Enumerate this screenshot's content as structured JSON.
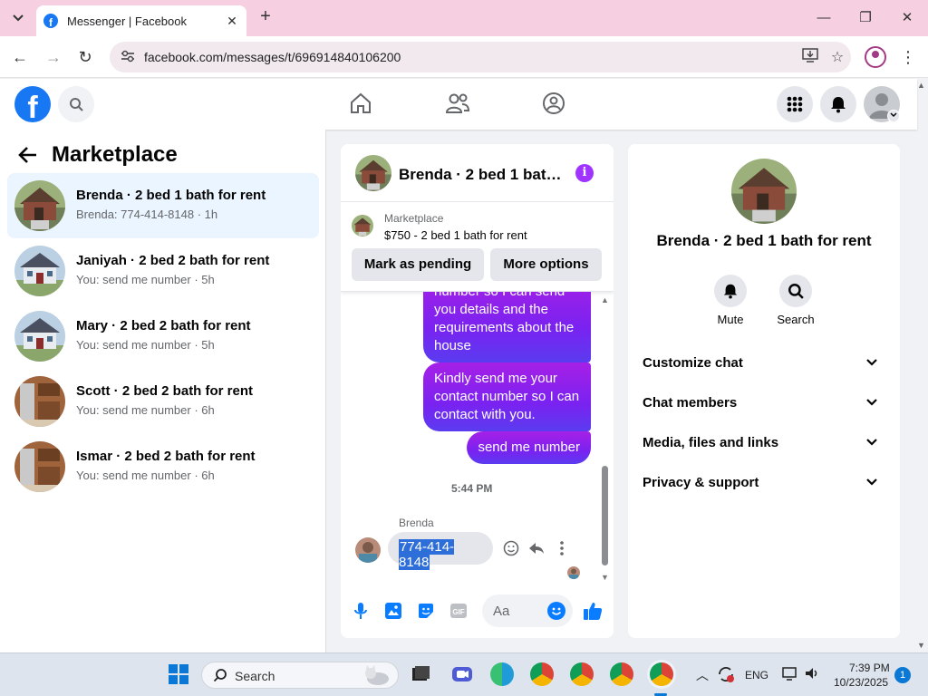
{
  "browser": {
    "tab_title": "Messenger | Facebook",
    "url": "facebook.com/messages/t/696914840106200"
  },
  "marketplace": {
    "title": "Marketplace",
    "conversations": [
      {
        "name": "Brenda · 2 bed 1 bath for rent",
        "preview": "Brenda: 774-414-8148 · 1h",
        "active": true
      },
      {
        "name": "Janiyah · 2 bed 2 bath for rent",
        "preview": "You: send me number · 5h"
      },
      {
        "name": "Mary · 2 bed 2 bath for rent",
        "preview": "You: send me number · 5h"
      },
      {
        "name": "Scott · 2 bed 2 bath for rent",
        "preview": "You: send me number · 6h"
      },
      {
        "name": "Ismar · 2 bed 2 bath for rent",
        "preview": "You: send me number · 6h"
      }
    ]
  },
  "chat": {
    "title": "Brenda · 2 bed 1 bath for rent",
    "card_label": "Marketplace",
    "card_price": "$750 - 2 bed 1 bath for rent",
    "btn_pending": "Mark as pending",
    "btn_more": "More options",
    "messages_out": [
      "number so I can send you details and the requirements about the house",
      "Kindly send me your contact number so I can contact with you.",
      "send me number"
    ],
    "time": "5:44 PM",
    "sender": "Brenda",
    "incoming": "774-414-8148",
    "composer_placeholder": "Aa",
    "gif_label": "GIF"
  },
  "details": {
    "title": "Brenda · 2 bed 1 bath for rent",
    "mute": "Mute",
    "search": "Search",
    "sections": [
      "Customize chat",
      "Chat members",
      "Media, files and links",
      "Privacy & support"
    ]
  },
  "taskbar": {
    "search": "Search",
    "lang": "ENG",
    "time": "7:39 PM",
    "date": "10/23/2025",
    "notifications": "1"
  },
  "colors": {
    "accent": "#0a7cff",
    "bubble_start": "#a620e6",
    "bubble_end": "#5a3cf0",
    "facebook_blue": "#1877f2"
  }
}
